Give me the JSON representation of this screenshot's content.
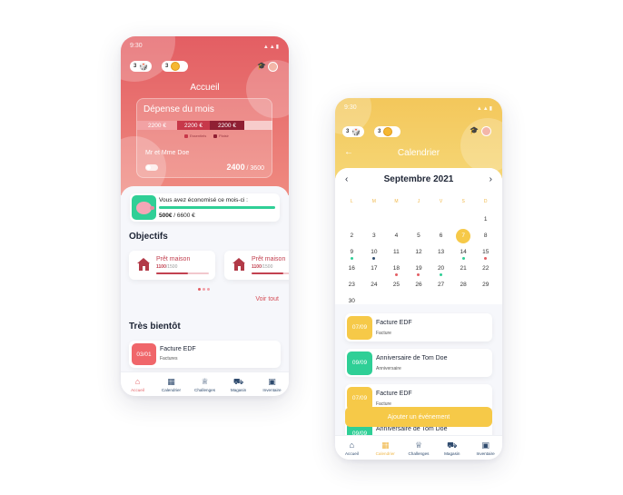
{
  "colors": {
    "red": "#e35e63",
    "yellow": "#f6c948",
    "green": "#2fcf96",
    "navy": "#2f4b6e"
  },
  "left_screen": {
    "status_time": "9:30",
    "chip_count_1": "3",
    "chip_count_2": "3",
    "title": "Accueil",
    "spending": {
      "title": "Dépense du mois",
      "segments": [
        "2200 €",
        "2200 €",
        "2200 €"
      ],
      "legend": [
        "Essentiels",
        "Plaisir"
      ],
      "person": "Mr et Mme Doe",
      "amount": "2400",
      "total": " / 3600"
    },
    "savings": {
      "text": "Vous avez économisé ce mois-ci :",
      "amount": "500€",
      "total": " / 6600 €"
    },
    "objectives_title": "Objectifs",
    "goals": [
      {
        "name": "Prêt maison",
        "progress": "1100",
        "target": "/1500"
      },
      {
        "name": "Prêt maison",
        "progress": "1100",
        "target": "/1500"
      }
    ],
    "see_all": "Voir tout",
    "soon_title": "Très bientôt",
    "event": {
      "date": "03/01",
      "title": "Facture EDF",
      "sub": "Factures"
    },
    "tabs": [
      {
        "icon": "home-icon",
        "label": "Accueil",
        "active": true
      },
      {
        "icon": "calendar-icon",
        "label": "Calendrier"
      },
      {
        "icon": "trophy-icon",
        "label": "Challenges"
      },
      {
        "icon": "cart-icon",
        "label": "Magasin"
      },
      {
        "icon": "briefcase-icon",
        "label": "Inventaire"
      }
    ]
  },
  "right_screen": {
    "status_time": "9:30",
    "chip_count_1": "3",
    "chip_count_2": "3",
    "title": "Calendrier",
    "month": "Septembre 2021",
    "weekdays": [
      "L",
      "M",
      "M",
      "J",
      "V",
      "S",
      "D"
    ],
    "days": [
      {
        "d": ""
      },
      {
        "d": ""
      },
      {
        "d": ""
      },
      {
        "d": ""
      },
      {
        "d": ""
      },
      {
        "d": ""
      },
      {
        "d": "1"
      },
      {
        "d": "2"
      },
      {
        "d": "3"
      },
      {
        "d": "4"
      },
      {
        "d": "5"
      },
      {
        "d": "6"
      },
      {
        "d": "7",
        "today": true
      },
      {
        "d": "8"
      },
      {
        "d": "9",
        "dot": "#2fcf96"
      },
      {
        "d": "10",
        "dot": "#2f4b6e"
      },
      {
        "d": "11"
      },
      {
        "d": "12"
      },
      {
        "d": "13"
      },
      {
        "d": "14",
        "dot": "#2fcf96"
      },
      {
        "d": "15",
        "dot": "#e35e63"
      },
      {
        "d": "16"
      },
      {
        "d": "17"
      },
      {
        "d": "18",
        "dot": "#e35e63"
      },
      {
        "d": "19",
        "dot": "#e35e63"
      },
      {
        "d": "20",
        "dot": "#2fcf96"
      },
      {
        "d": "21"
      },
      {
        "d": "22"
      },
      {
        "d": "23"
      },
      {
        "d": "24"
      },
      {
        "d": "25"
      },
      {
        "d": "26"
      },
      {
        "d": "27"
      },
      {
        "d": "28"
      },
      {
        "d": "29"
      },
      {
        "d": "30"
      }
    ],
    "events": [
      {
        "date": "07/09",
        "title": "Facture EDF",
        "sub": "Facture",
        "color": "#f6c948"
      },
      {
        "date": "09/09",
        "title": "Anniversaire de Tom Doe",
        "sub": "Anniversaire",
        "color": "#2fcf96"
      },
      {
        "date": "07/09",
        "title": "Facture EDF",
        "sub": "Facture",
        "color": "#f6c948"
      },
      {
        "date": "09/09",
        "title": "Anniversaire de Tom Doe",
        "sub": "",
        "color": "#2fcf96"
      }
    ],
    "add_button": "Ajouter un événement",
    "tabs": [
      {
        "icon": "home-icon",
        "label": "Accueil"
      },
      {
        "icon": "calendar-icon",
        "label": "Calendrier",
        "active": true
      },
      {
        "icon": "trophy-icon",
        "label": "Challenges"
      },
      {
        "icon": "cart-icon",
        "label": "Magasin"
      },
      {
        "icon": "briefcase-icon",
        "label": "Inventaire"
      }
    ]
  }
}
